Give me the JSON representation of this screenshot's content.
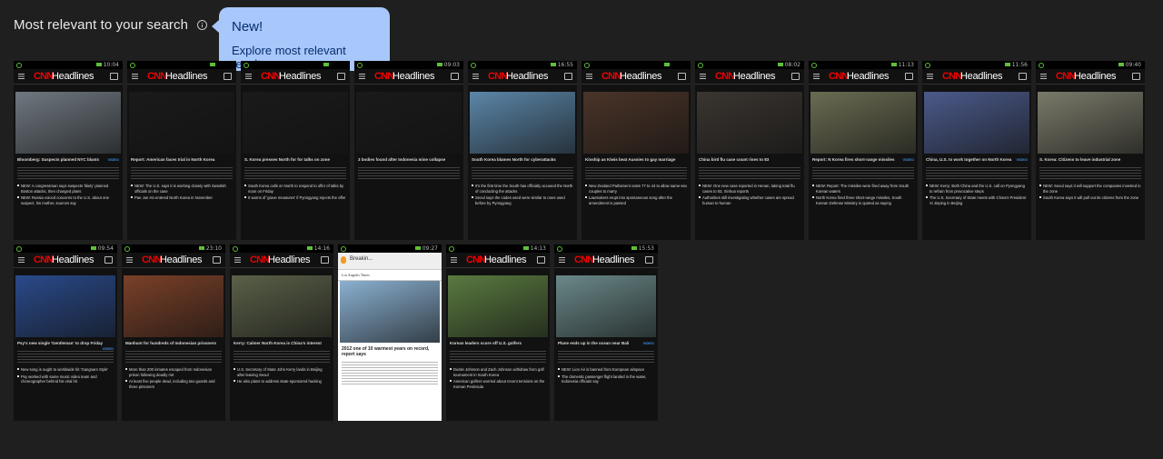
{
  "header": {
    "title": "Most relevant to your search",
    "info_icon": "info-icon"
  },
  "tooltip": {
    "title": "New!",
    "body": "Explore most relevant results"
  },
  "app": {
    "logo_cnn": "CNN",
    "logo_rest": "Headlines"
  },
  "colors": {
    "background": "#1f1f1f",
    "tooltip_bg": "#a8c7fa",
    "cnn_red": "#e00000",
    "video_blue": "#3a8ee6"
  },
  "row1": [
    {
      "time": "10:04",
      "headline": "Bloomberg: Suspects planned NYC blasts",
      "video": "VIDEO",
      "bullets": [
        "NEW: A congressman says suspects 'likely' planned Boston attacks, then changed plans",
        "NEW: Russia voiced concerns to the U.S. about one suspect, his mother, sources say"
      ],
      "photo": "#6f7880"
    },
    {
      "time": "",
      "headline": "Report: American faces trial in North Korea",
      "video": "",
      "bullets": [
        "NEW: The U.S. says it is working closely with Swedish officials on the case",
        "Pae Jun Ho entered North Korea in November"
      ],
      "photo": "#1a1a1a"
    },
    {
      "time": "",
      "headline": "S. Korea presses North for for talks on zone",
      "video": "",
      "bullets": [
        "South Korea calls on North to respond to offer of talks by noon on Friday",
        "It warns of 'grave measures' if Pyongyang rejects the offer"
      ],
      "photo": "#1a1a1a"
    },
    {
      "time": "09:03",
      "headline": "3 bodies found after Indonesia mine collapse",
      "video": "",
      "bullets": [],
      "photo": "#1a1a1a"
    },
    {
      "time": "16:55",
      "headline": "South Korea blames North for cyberattacks",
      "video": "",
      "bullets": [
        "It's the first time the South has officially accused the North of conducting the attacks",
        "Seoul says the codes used were similar to ones used before by Pyongyang"
      ],
      "photo": "#5b86a8"
    },
    {
      "time": "",
      "headline": "Kinship as Kiwis beat Aussies to gay marriage",
      "video": "",
      "bullets": [
        "New Zealand Parliament votes 77 to 44 to allow same-sex couples to marry",
        "Lawmakers erupt into spontaneous song after the amendment is passed"
      ],
      "photo": "#4a3428"
    },
    {
      "time": "08:02",
      "headline": "China bird flu case count rises to 83",
      "video": "",
      "bullets": [
        "NEW: One new case reported in Henan, taking total flu cases to 83, Xinhua reports",
        "Authorities still investigating whether cases are spread human to human"
      ],
      "photo": "#3a3530"
    },
    {
      "time": "11:13",
      "headline": "Report: N Korea fires short-range missiles",
      "video": "VIDEO",
      "bullets": [
        "NEW: Report: The missiles were fired away from South Korean waters",
        "North Korea fired three short-range missiles, South Korean Defense Ministry is quoted as saying"
      ],
      "photo": "#6a6c52"
    },
    {
      "time": "11:56",
      "headline": "China, U.S. to work together on North Korea",
      "video": "VIDEO",
      "bullets": [
        "NEW: Kerry: Both China and the U.S. call on Pyongyang to refrain from provocative steps",
        "The U.S. Secretary of State meets with China's President Xi Jinping in Beijing"
      ],
      "photo": "#4b5a8a"
    },
    {
      "time": "09:40",
      "headline": "S. Korea: Citizens to leave industrial zone",
      "video": "",
      "bullets": [
        "NEW: Seoul says it will support the companies invested in the zone",
        "South Korea says it will pull out its citizens from the zone"
      ],
      "photo": "#7a7a6a"
    }
  ],
  "row2": [
    {
      "time": "09:54",
      "headline": "Psy's new single 'Gentleman' to drop Friday",
      "video": "VIDEO",
      "bullets": [
        "New song is ought to worldwide hit 'Gangnam Style'",
        "Psy worked with same music video team and choreographer behind his viral hit"
      ],
      "photo": "#2a4a8a",
      "browser": false
    },
    {
      "time": "23:10",
      "headline": "Manhunt for hundreds of Indonesian prisoners",
      "video": "",
      "bullets": [
        "More than 200 inmates escaped from Indonesian prison following deadly riot",
        "At least five people dead, including two guards and three prisoners"
      ],
      "photo": "#7a4028",
      "browser": false
    },
    {
      "time": "14:16",
      "headline": "Kerry: Calmer North Korea is China's interest",
      "video": "",
      "bullets": [
        "U.S. Secretary of State John Kerry lands in Beijing after leaving Seoul",
        "He also plans to address state-sponsored hacking"
      ],
      "photo": "#5a6048",
      "browser": false
    },
    {
      "time": "09:27",
      "headline": "2012 one of 10 warmest years on record, report says",
      "video": "",
      "bullets": [],
      "photo": "#8ab0d0",
      "browser": true,
      "tab_title": "Breakin...",
      "site": "Los Angeles Times"
    },
    {
      "time": "14:13",
      "headline": "Korean leaders score off U.S. golfers",
      "video": "",
      "bullets": [
        "Dustin Johnson and Zach Johnson withdraw from golf tournament in South Korea",
        "American golfers worried about recent tensions on the Korean Peninsula"
      ],
      "photo": "#5a7a40",
      "browser": false
    },
    {
      "time": "15:53",
      "headline": "Plane ends up in the ocean near Bali",
      "video": "VIDEO",
      "bullets": [
        "NEW: Lion Air is banned from European airspace",
        "The domestic passenger flight landed in the water, Indonesia officials say"
      ],
      "photo": "#6a8888",
      "browser": false
    }
  ]
}
